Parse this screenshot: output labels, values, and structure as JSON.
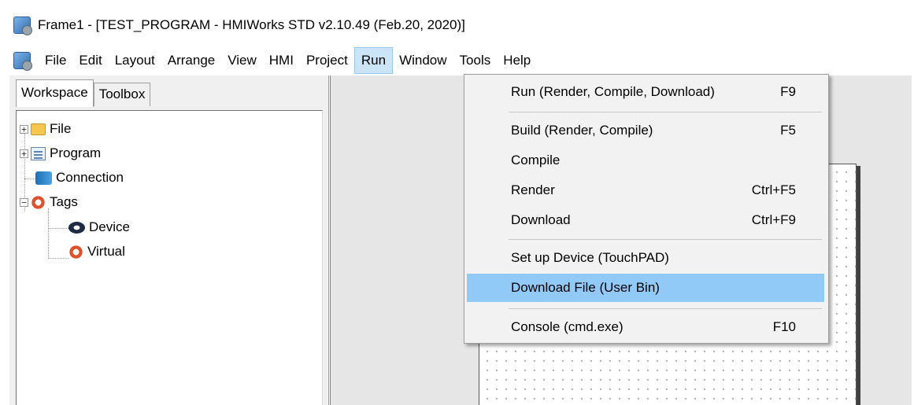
{
  "window": {
    "title": "Frame1 - [TEST_PROGRAM - HMIWorks STD v2.10.49 (Feb.20, 2020)]",
    "app_icon": "hmiworks-app-icon"
  },
  "menu_bar": {
    "items": [
      "File",
      "Edit",
      "Layout",
      "Arrange",
      "View",
      "HMI",
      "Project",
      "Run",
      "Window",
      "Tools",
      "Help"
    ],
    "active": "Run"
  },
  "left_panel": {
    "tabs": [
      {
        "label": "Workspace",
        "selected": true
      },
      {
        "label": "Toolbox",
        "selected": false
      }
    ],
    "tree": [
      {
        "label": "File",
        "icon": "folder-icon",
        "expander": "+"
      },
      {
        "label": "Program",
        "icon": "program-icon",
        "expander": "+"
      },
      {
        "label": "Connection",
        "icon": "connection-icon",
        "expander": ""
      },
      {
        "label": "Tags",
        "icon": "tags-icon",
        "expander": "−"
      },
      {
        "label": "Device",
        "icon": "device-icon",
        "expander": ""
      },
      {
        "label": "Virtual",
        "icon": "tags-icon",
        "expander": ""
      }
    ]
  },
  "run_menu": {
    "items": [
      {
        "label": "Run (Render, Compile, Download)",
        "shortcut": "F9"
      },
      {
        "label": "Build (Render, Compile)",
        "shortcut": "F5"
      },
      {
        "label": "Compile",
        "shortcut": ""
      },
      {
        "label": "Render",
        "shortcut": "Ctrl+F5"
      },
      {
        "label": "Download",
        "shortcut": "Ctrl+F9"
      },
      {
        "label": "Set up Device (TouchPAD)",
        "shortcut": ""
      },
      {
        "label": "Download File (User Bin)",
        "shortcut": "",
        "highlighted": true
      },
      {
        "label": "Console (cmd.exe)",
        "shortcut": "F10"
      }
    ]
  },
  "colors": {
    "menu_highlight": "#91c9f7",
    "active_menu_bg": "#cce4f7",
    "panel_bg": "#f0f0f0",
    "canvas_bg": "#e6e6e6"
  }
}
